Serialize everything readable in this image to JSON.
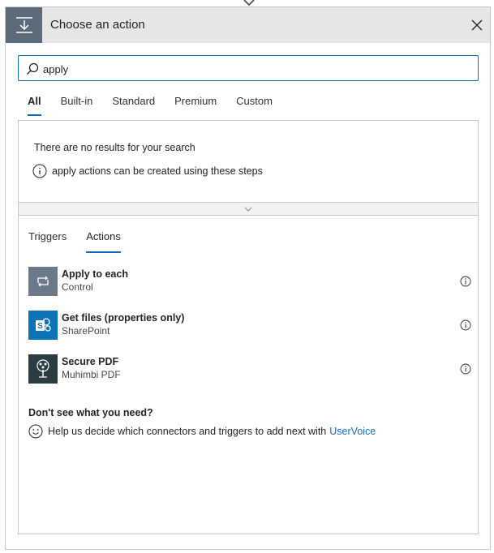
{
  "dialog": {
    "title": "Choose an action"
  },
  "search": {
    "value": "apply",
    "placeholder": ""
  },
  "tabs": [
    {
      "label": "All",
      "active": true
    },
    {
      "label": "Built-in",
      "active": false
    },
    {
      "label": "Standard",
      "active": false
    },
    {
      "label": "Premium",
      "active": false
    },
    {
      "label": "Custom",
      "active": false
    }
  ],
  "noresults": {
    "title": "There are no results for your search",
    "hint": "apply actions can be created using these steps"
  },
  "subtabs": [
    {
      "label": "Triggers",
      "active": false
    },
    {
      "label": "Actions",
      "active": true
    }
  ],
  "actions": [
    {
      "name": "Apply to each",
      "connector": "Control",
      "icon": "loop-icon",
      "color": "#6b7a8a"
    },
    {
      "name": "Get files (properties only)",
      "connector": "SharePoint",
      "icon": "sharepoint-icon",
      "color": "#0b73b8"
    },
    {
      "name": "Secure PDF",
      "connector": "Muhimbi PDF",
      "icon": "tree-icon",
      "color": "#2a3d44"
    }
  ],
  "help": {
    "title": "Don't see what you need?",
    "text": "Help us decide which connectors and triggers to add next with",
    "link": "UserVoice"
  },
  "colors": {
    "accent": "#0f6cbd",
    "header_bg": "#e6e6e6",
    "header_icon_bg": "#5c6b7a"
  }
}
